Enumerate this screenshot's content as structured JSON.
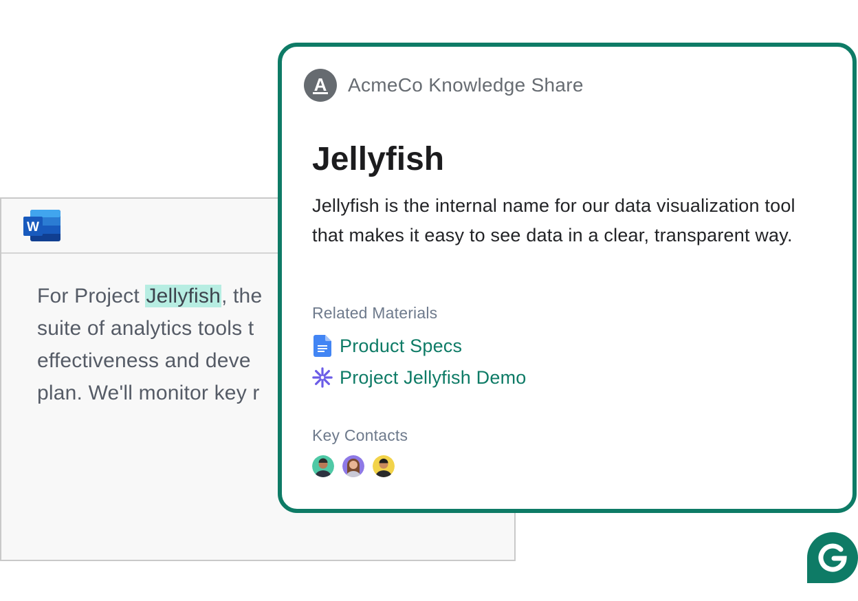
{
  "word_document": {
    "app_icon": "microsoft-word-icon",
    "app_icon_letter": "W",
    "lines": [
      {
        "before": "For Project ",
        "highlight": "Jellyfish",
        "after": ", the"
      },
      {
        "text": "suite of analytics tools t"
      },
      {
        "text": "effectiveness and deve"
      },
      {
        "text": "plan. We'll monitor key r"
      }
    ]
  },
  "card": {
    "source": {
      "avatar_letter": "A",
      "name": "AcmeCo Knowledge Share"
    },
    "title": "Jellyfish",
    "description": "Jellyfish is the internal name for our data visualization tool that makes it easy to see data in a clear, transparent way.",
    "related_materials": {
      "label": "Related Materials",
      "items": [
        {
          "label": "Product Specs",
          "icon": "google-docs-icon"
        },
        {
          "label": "Project Jellyfish Demo",
          "icon": "sparkle-asterisk-icon"
        }
      ]
    },
    "key_contacts": {
      "label": "Key Contacts",
      "contacts": [
        {
          "icon": "contact-avatar",
          "color": "#4fc9a6"
        },
        {
          "icon": "contact-avatar",
          "color": "#8e79e6"
        },
        {
          "icon": "contact-avatar",
          "color": "#f2d34a"
        }
      ]
    }
  },
  "brand": {
    "icon": "grammarly-logo-icon",
    "accent": "#0e7b66",
    "highlight": "#b7ede2"
  }
}
